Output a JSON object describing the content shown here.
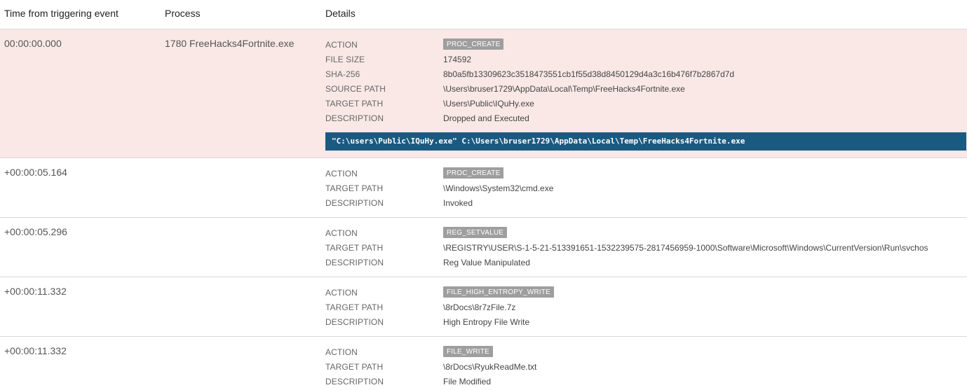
{
  "header": {
    "time": "Time from triggering event",
    "process": "Process",
    "details": "Details"
  },
  "rows": [
    {
      "time": "00:00:00.000",
      "process": "1780 FreeHacks4Fortnite.exe",
      "action": "PROC_CREATE",
      "file_size": "174592",
      "sha256": "8b0a5fb13309623c3518473551cb1f55d38d8450129d4a3c16b476f7b2867d7d",
      "source_path": "\\Users\\bruser1729\\AppData\\Local\\Temp\\FreeHacks4Fortnite.exe",
      "target_path": "\\Users\\Public\\IQuHy.exe",
      "description": "Dropped and Executed",
      "command_line": "\"C:\\users\\Public\\IQuHy.exe\" C:\\Users\\bruser1729\\AppData\\Local\\Temp\\FreeHacks4Fortnite.exe"
    },
    {
      "time": "+00:00:05.164",
      "process": "",
      "action": "PROC_CREATE",
      "target_path": "\\Windows\\System32\\cmd.exe",
      "description": "Invoked"
    },
    {
      "time": "+00:00:05.296",
      "process": "",
      "action": "REG_SETVALUE",
      "target_path": "\\REGISTRY\\USER\\S-1-5-21-513391651-1532239575-2817456959-1000\\Software\\Microsoft\\Windows\\CurrentVersion\\Run\\svchos",
      "description": "Reg Value Manipulated"
    },
    {
      "time": "+00:00:11.332",
      "process": "",
      "action": "FILE_HIGH_ENTROPY_WRITE",
      "target_path": "\\8rDocs\\8r7zFile.7z",
      "description": "High Entropy File Write"
    },
    {
      "time": "+00:00:11.332",
      "process": "",
      "action": "FILE_WRITE",
      "target_path": "\\8rDocs\\RyukReadMe.txt",
      "description": "File Modified"
    }
  ],
  "labels": {
    "action": "ACTION",
    "file_size": "FILE SIZE",
    "sha256": "SHA-256",
    "source_path": "SOURCE PATH",
    "target_path": "TARGET PATH",
    "description": "DESCRIPTION"
  },
  "colors": {
    "highlight_row": "#f9e8e6",
    "badge": "#9e9e9e",
    "command_bar": "#1b5a80"
  }
}
